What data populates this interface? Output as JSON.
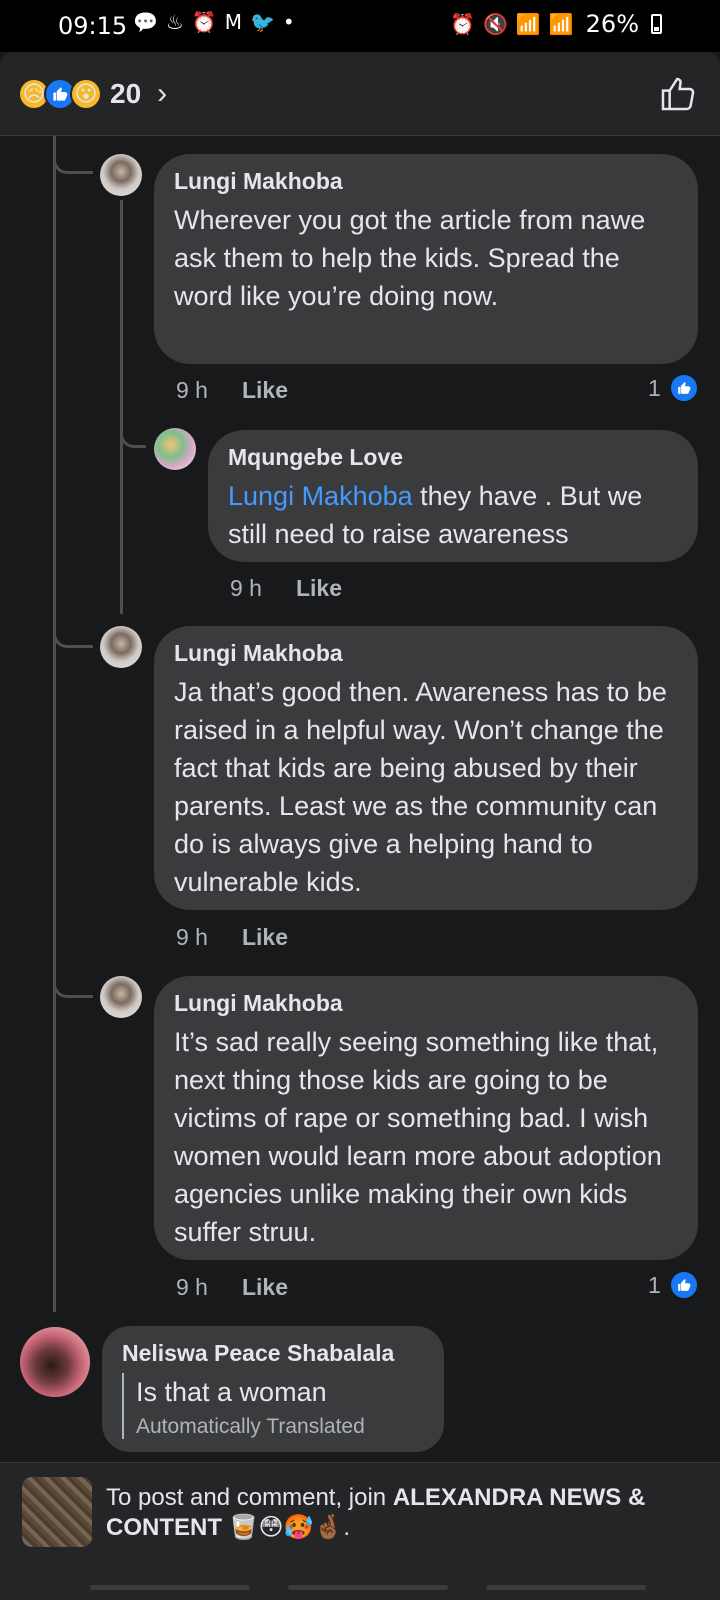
{
  "status_bar": {
    "time": "09:15",
    "left_icons": [
      "chat-icon",
      "alert-icon",
      "alarm-icon",
      "gmail-icon",
      "twitter-icon",
      "dot-icon"
    ],
    "battery": "26%"
  },
  "header": {
    "reactions": [
      "sad",
      "like",
      "wow"
    ],
    "reaction_count": "20",
    "chevron": "›"
  },
  "comments": [
    {
      "author": "Lungi Makhoba",
      "text": "Wherever you got the article from nawe ask them to help the kids. Spread the word like you’re doing now.",
      "time": "9 h",
      "like_label": "Like",
      "like_count": "1"
    },
    {
      "author": "Mqungebe Love",
      "mention": "Lungi Makhoba",
      "text": " they have . But we still need to raise awareness",
      "time": "9 h",
      "like_label": "Like"
    },
    {
      "author": "Lungi Makhoba",
      "text": "Ja that’s good then. Awareness has to be raised in a helpful way. Won’t change the fact that kids are being abused by their parents. Least we as the community can do is always give a helping hand to vulnerable kids.",
      "time": "9 h",
      "like_label": "Like"
    },
    {
      "author": "Lungi Makhoba",
      "text": "It’s sad really seeing something like that, next thing those kids are going to be victims of rape or something bad. I wish women would learn more about adoption agencies unlike making their own kids suffer struu.",
      "time": "9 h",
      "like_label": "Like",
      "like_count": "1"
    },
    {
      "author": "Neliswa Peace Shabalala",
      "text": "Is that a woman",
      "translated_label": "Automatically Translated"
    }
  ],
  "bottom": {
    "prefix": "To post and comment, join ",
    "group_name": "ALEXANDRA NEWS & CONTENT",
    "suffix": " 🥃😳🥵🤞🏾."
  },
  "colors": {
    "background": "#18191a",
    "bubble": "#3a3b3c",
    "accent": "#1877f2",
    "mention": "#4599ff",
    "muted": "#b0b3b8"
  }
}
